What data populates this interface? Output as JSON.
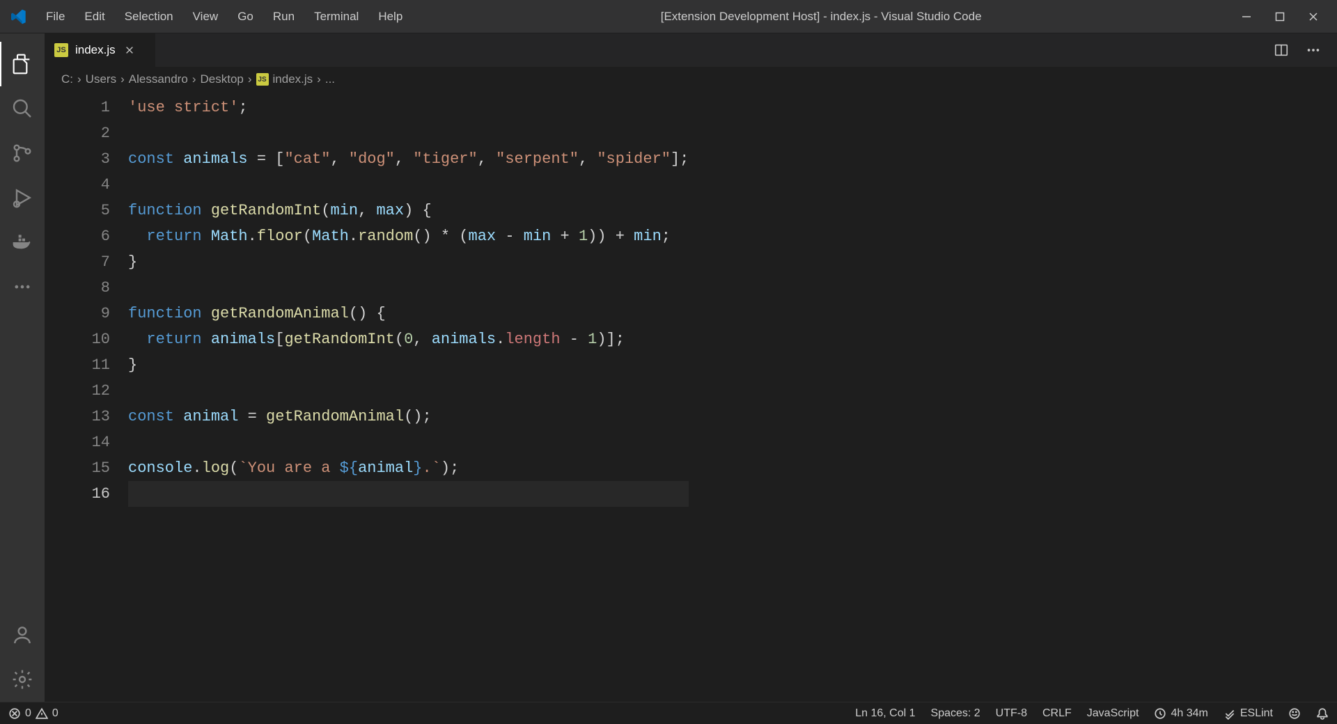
{
  "titlebar": {
    "menu": [
      "File",
      "Edit",
      "Selection",
      "View",
      "Go",
      "Run",
      "Terminal",
      "Help"
    ],
    "title": "[Extension Development Host] - index.js - Visual Studio Code"
  },
  "tabs": {
    "active": {
      "icon": "js",
      "label": "index.js"
    }
  },
  "breadcrumbs": {
    "segments": [
      "C:",
      "Users",
      "Alessandro",
      "Desktop"
    ],
    "file": "index.js",
    "tail": "..."
  },
  "code": {
    "lines": [
      [
        {
          "c": "str",
          "t": "'use strict'"
        },
        {
          "c": "pl",
          "t": ";"
        }
      ],
      [],
      [
        {
          "c": "kw",
          "t": "const "
        },
        {
          "c": "var",
          "t": "animals"
        },
        {
          "c": "pl",
          "t": " = ["
        },
        {
          "c": "str",
          "t": "\"cat\""
        },
        {
          "c": "pl",
          "t": ", "
        },
        {
          "c": "str",
          "t": "\"dog\""
        },
        {
          "c": "pl",
          "t": ", "
        },
        {
          "c": "str",
          "t": "\"tiger\""
        },
        {
          "c": "pl",
          "t": ", "
        },
        {
          "c": "str",
          "t": "\"serpent\""
        },
        {
          "c": "pl",
          "t": ", "
        },
        {
          "c": "str",
          "t": "\"spider\""
        },
        {
          "c": "pl",
          "t": "];"
        }
      ],
      [],
      [
        {
          "c": "kw",
          "t": "function "
        },
        {
          "c": "fn",
          "t": "getRandomInt"
        },
        {
          "c": "pl",
          "t": "("
        },
        {
          "c": "var",
          "t": "min"
        },
        {
          "c": "pl",
          "t": ", "
        },
        {
          "c": "var",
          "t": "max"
        },
        {
          "c": "pl",
          "t": ") {"
        }
      ],
      [
        {
          "c": "pl",
          "t": "  "
        },
        {
          "c": "kw",
          "t": "return "
        },
        {
          "c": "var",
          "t": "Math"
        },
        {
          "c": "pl",
          "t": "."
        },
        {
          "c": "fn",
          "t": "floor"
        },
        {
          "c": "pl",
          "t": "("
        },
        {
          "c": "var",
          "t": "Math"
        },
        {
          "c": "pl",
          "t": "."
        },
        {
          "c": "fn",
          "t": "random"
        },
        {
          "c": "pl",
          "t": "() * ("
        },
        {
          "c": "var",
          "t": "max"
        },
        {
          "c": "pl",
          "t": " - "
        },
        {
          "c": "var",
          "t": "min"
        },
        {
          "c": "pl",
          "t": " + "
        },
        {
          "c": "num",
          "t": "1"
        },
        {
          "c": "pl",
          "t": ")) + "
        },
        {
          "c": "var",
          "t": "min"
        },
        {
          "c": "pl",
          "t": ";"
        }
      ],
      [
        {
          "c": "pl",
          "t": "}"
        }
      ],
      [],
      [
        {
          "c": "kw",
          "t": "function "
        },
        {
          "c": "fn",
          "t": "getRandomAnimal"
        },
        {
          "c": "pl",
          "t": "() {"
        }
      ],
      [
        {
          "c": "pl",
          "t": "  "
        },
        {
          "c": "kw",
          "t": "return "
        },
        {
          "c": "var",
          "t": "animals"
        },
        {
          "c": "pl",
          "t": "["
        },
        {
          "c": "fn",
          "t": "getRandomInt"
        },
        {
          "c": "pl",
          "t": "("
        },
        {
          "c": "num",
          "t": "0"
        },
        {
          "c": "pl",
          "t": ", "
        },
        {
          "c": "var",
          "t": "animals"
        },
        {
          "c": "pl",
          "t": "."
        },
        {
          "c": "mem",
          "t": "length"
        },
        {
          "c": "pl",
          "t": " - "
        },
        {
          "c": "num",
          "t": "1"
        },
        {
          "c": "pl",
          "t": ")];"
        }
      ],
      [
        {
          "c": "pl",
          "t": "}"
        }
      ],
      [],
      [
        {
          "c": "kw",
          "t": "const "
        },
        {
          "c": "var",
          "t": "animal"
        },
        {
          "c": "pl",
          "t": " = "
        },
        {
          "c": "fn",
          "t": "getRandomAnimal"
        },
        {
          "c": "pl",
          "t": "();"
        }
      ],
      [],
      [
        {
          "c": "var",
          "t": "console"
        },
        {
          "c": "pl",
          "t": "."
        },
        {
          "c": "fn",
          "t": "log"
        },
        {
          "c": "pl",
          "t": "("
        },
        {
          "c": "str",
          "t": "`You are a "
        },
        {
          "c": "kw",
          "t": "${"
        },
        {
          "c": "var",
          "t": "animal"
        },
        {
          "c": "kw",
          "t": "}"
        },
        {
          "c": "str",
          "t": ".`"
        },
        {
          "c": "pl",
          "t": ");"
        }
      ],
      []
    ],
    "current_line": 16
  },
  "status": {
    "errors": "0",
    "warnings": "0",
    "position": "Ln 16, Col 1",
    "spaces": "Spaces: 2",
    "encoding": "UTF-8",
    "eol": "CRLF",
    "language": "JavaScript",
    "time": "4h 34m",
    "eslint": "ESLint"
  }
}
